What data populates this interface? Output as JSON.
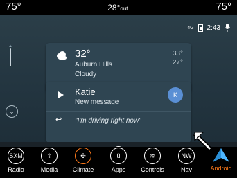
{
  "topbar": {
    "temp_left": "75°",
    "outside_temp": "28°",
    "outside_suffix": "out.",
    "temp_right": "75°"
  },
  "status": {
    "signal": "4G",
    "time": "2:43"
  },
  "weather": {
    "temp": "32°",
    "location": "Auburn Hills",
    "condition": "Cloudy",
    "high": "33°",
    "low": "27°"
  },
  "message": {
    "sender": "Katie",
    "subtitle": "New message",
    "avatar": "K",
    "reply": "\"I'm driving right now\""
  },
  "bottom": {
    "items": [
      {
        "label": "Radio",
        "icon": "SXM"
      },
      {
        "label": "Media",
        "icon": "usb-icon"
      },
      {
        "label": "Climate",
        "icon": "fan-icon"
      },
      {
        "label": "Apps",
        "icon": "ü"
      },
      {
        "label": "Controls",
        "icon": "seat-heat-icon"
      },
      {
        "label": "Nav",
        "icon": "NW"
      },
      {
        "label": "Android",
        "icon": "android-auto-icon"
      }
    ]
  },
  "colors": {
    "accent": "#ff7a1a",
    "android_blue": "#4db6ff"
  }
}
